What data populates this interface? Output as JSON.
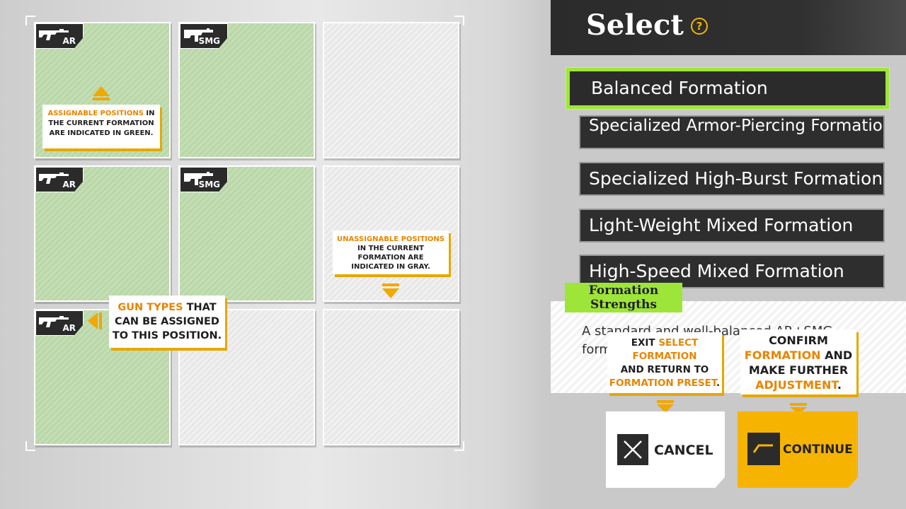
{
  "grid": {
    "cells": [
      {
        "state": "green",
        "gun": "AR"
      },
      {
        "state": "green",
        "gun": "SMG"
      },
      {
        "state": "gray",
        "gun": ""
      },
      {
        "state": "green",
        "gun": "AR"
      },
      {
        "state": "green",
        "gun": "SMG"
      },
      {
        "state": "gray",
        "gun": ""
      },
      {
        "state": "green",
        "gun": "AR"
      },
      {
        "state": "gray",
        "gun": ""
      },
      {
        "state": "gray",
        "gun": ""
      }
    ],
    "colors": {
      "assignable": "#b9d7a7",
      "unassignable": "#e7e7e7",
      "accent": "#f1a800",
      "highlight": "#e98400"
    }
  },
  "tips": {
    "assignable": {
      "hl": "ASSIGNABLE POSITIONS",
      "l1_rest": " IN",
      "l2": "THE CURRENT FORMATION",
      "l3": "ARE INDICATED IN GREEN."
    },
    "unassignable": {
      "hl": "UNASSIGNABLE POSITIONS",
      "l2": "IN THE CURRENT",
      "l3": "FORMATION ARE",
      "l4": "INDICATED IN GRAY."
    },
    "gun_types": {
      "hl": "GUN TYPES",
      "l1_rest": " THAT",
      "l2": "CAN BE ASSIGNED",
      "l3": "TO THIS POSITION."
    },
    "exit": {
      "l1a": "EXIT ",
      "l1b": "SELECT",
      "l2": "FORMATION",
      "l3": "AND RETURN TO",
      "l4": "FORMATION PRESET",
      "l4_end": "."
    },
    "confirm": {
      "l1": "CONFIRM",
      "l2a": "FORMATION",
      "l2b": " AND",
      "l3": "MAKE FURTHER",
      "l4": "ADJUSTMENT",
      "l4_end": "."
    }
  },
  "panel": {
    "title": "Select",
    "help_symbol": "?",
    "formations": [
      {
        "label": "Balanced Formation",
        "selected": true
      },
      {
        "label": "Specialized Armor-Piercing Formation",
        "selected": false
      },
      {
        "label": "Specialized High-Burst Formation",
        "selected": false
      },
      {
        "label": "Light-Weight Mixed Formation",
        "selected": false
      },
      {
        "label": "High-Speed Mixed Formation",
        "selected": false
      }
    ],
    "strengths_label": "Formation Strengths",
    "description": "A standard and well-balanced AR+SMG formation."
  },
  "buttons": {
    "cancel": "CANCEL",
    "continue": "CONTINUE"
  },
  "icons": {
    "help": "question-circle-icon",
    "cancel": "x-icon",
    "continue": "arrow-right-icon",
    "rifle": "assault-rifle-icon",
    "smg": "smg-icon"
  }
}
